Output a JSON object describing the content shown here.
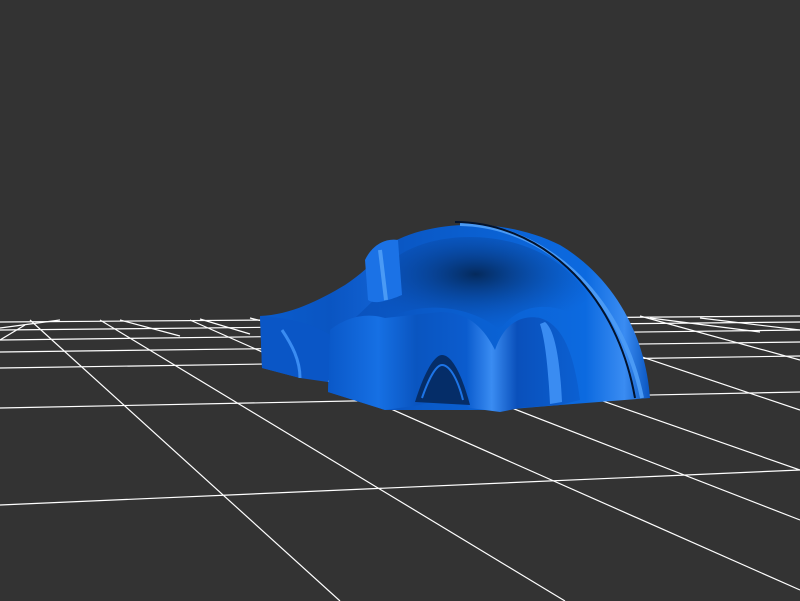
{
  "viewer": {
    "background_color": "#333333",
    "grid_color": "#ffffff",
    "model_color": "#0a5fd0",
    "model_highlight_color": "#3a8cf2",
    "model_shadow_color": "#04244f",
    "grid_visible": true
  }
}
